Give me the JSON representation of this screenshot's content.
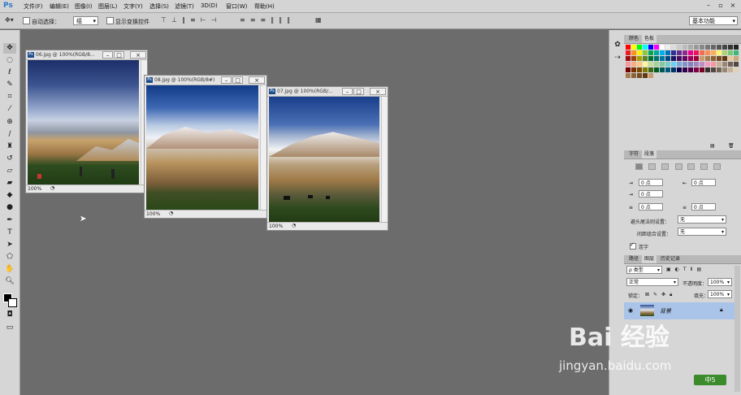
{
  "app": {
    "logo": "Ps"
  },
  "menu": [
    "文件(F)",
    "编辑(E)",
    "图像(I)",
    "图层(L)",
    "文字(Y)",
    "选择(S)",
    "滤镜(T)",
    "3D(D)",
    "视图(V)",
    "窗口(W)",
    "帮助(H)"
  ],
  "window_controls": {
    "minimize": "–",
    "restore": "▫",
    "close": "×"
  },
  "options": {
    "auto_select_label": "自动选择：",
    "auto_select_value": "组",
    "show_transform_label": "显示变换控件",
    "workspace": "基本功能"
  },
  "documents": [
    {
      "title": "06.jpg @ 100%(RGB/8...",
      "zoom": "100%"
    },
    {
      "title": "08.jpg @ 100%(RGB/8#)",
      "zoom": "100%"
    },
    {
      "title": "07.jpg @ 100%(RGB/...",
      "zoom": "100%"
    }
  ],
  "doc_buttons": {
    "min": "–",
    "max": "□",
    "close": "×"
  },
  "panels": {
    "color_tabs": [
      "颜色",
      "色板"
    ],
    "char_tabs": [
      "字符",
      "段落"
    ],
    "paragraph": {
      "indent_left": "0 点",
      "indent_right": "0 点",
      "first_line": "0 点",
      "space_before": "0 点",
      "space_after": "0 点",
      "avoid_label": "避头尾法则设置：",
      "avoid_value": "无",
      "spacing_label": "间距组合设置：",
      "spacing_value": "无",
      "hyphen_label": "连字"
    },
    "layer_tabs": [
      "路径",
      "图层",
      "历史记录"
    ],
    "layers": {
      "filter_kind": "ρ 类型",
      "blend_mode": "正常",
      "opacity_label": "不透明度：",
      "opacity_value": "100%",
      "lock_label": "锁定：",
      "fill_label": "填充：",
      "fill_value": "100%",
      "layer_name": "背景"
    }
  },
  "watermark": {
    "brand": "Bai 经验",
    "url": "jingyan.baidu.com",
    "badge": "中5"
  },
  "colors": {
    "accent": "#2d78c8",
    "layer_selected": "#a9c4e8"
  }
}
